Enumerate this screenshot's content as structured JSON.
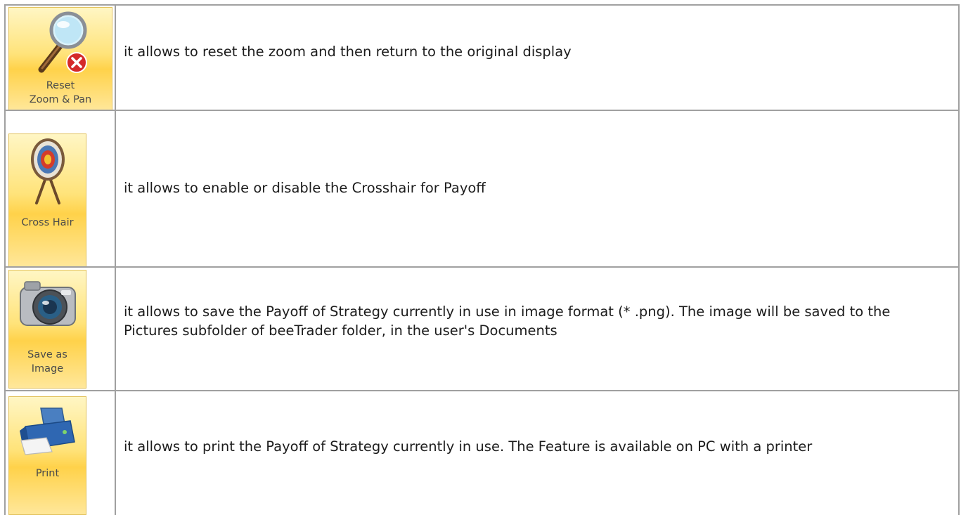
{
  "rows": [
    {
      "button": {
        "label_line1": "Reset",
        "label_line2": "Zoom & Pan",
        "icon": "magnifier-reset-icon"
      },
      "description": "it allows to reset the zoom and then return to the original display"
    },
    {
      "button": {
        "label_line1": "Cross Hair",
        "icon": "target-easel-icon"
      },
      "description": "it allows to enable or disable the Crosshair for Payoff"
    },
    {
      "button": {
        "label_line1": "Save as",
        "label_line2": "Image",
        "icon": "camera-icon"
      },
      "description": "it allows to save the Payoff of Strategy currently in use in image format (* .png). The image will be saved to the Pictures subfolder of beeTrader folder, in the user's Documents"
    },
    {
      "button": {
        "label_line1": "Print",
        "icon": "printer-icon"
      },
      "description": "it allows to print the Payoff of Strategy currently in use. The Feature is available on PC with a printer"
    }
  ],
  "colors": {
    "button_gradient_top": "#fff6c4",
    "button_gradient_mid": "#ffd24a",
    "button_border": "#e2c15c",
    "grid_line": "#a0a0a0"
  }
}
